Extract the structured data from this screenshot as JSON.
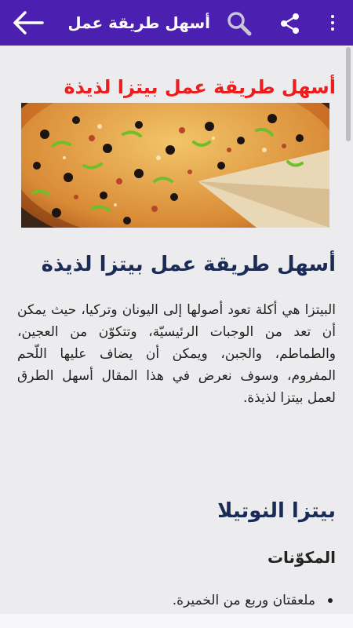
{
  "appbar": {
    "title": "أسهل طريقة عمل...",
    "icons": [
      "back-arrow-icon",
      "search-icon",
      "share-icon",
      "overflow-menu-icon"
    ],
    "color": "#4b1fb0"
  },
  "article": {
    "red_title": "أسهل طريقة عمل بيتزا لذيذة",
    "image": "pizza-photo",
    "heading": "أسهل طريقة عمل بيتزا لذيذة",
    "paragraph": "البيتزا هي أكلة تعود أصولها إلى اليونان وتركيا، حيث يمكن أن تعد من الوجبات الرئيسيّة، وتتكوّن من العجين، والطماطم، والجبن، ويمكن أن يضاف عليها اللّحم المفروم، وسوف نعرض في هذا المقال أسهل الطرق لعمل بيتزا لذيذة.",
    "subheading": "بيتزا النوتيلا",
    "ingredients_title": "المكوّنات",
    "ingredients": [
      "ملعقتان وربع من الخميرة."
    ]
  },
  "colors": {
    "red_title": "#ee1c1c",
    "heading": "#1a2c56"
  }
}
